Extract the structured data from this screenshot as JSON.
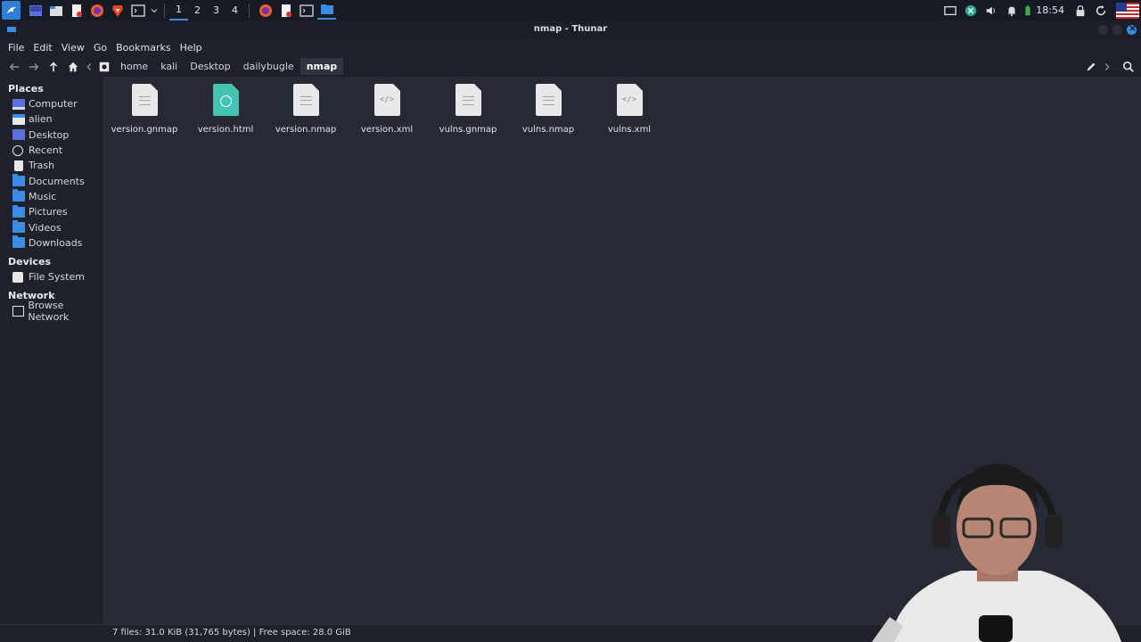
{
  "panel": {
    "workspaces": [
      "1",
      "2",
      "3",
      "4"
    ],
    "active_workspace": "1",
    "clock": "18:54",
    "launcher_icons": [
      "kali-menu-icon",
      "desktop-icon",
      "file-manager-icon",
      "text-editor-icon",
      "firefox-icon",
      "brave-icon",
      "terminal-icon"
    ],
    "task_icons": [
      "firefox-task-icon",
      "text-editor-task-icon",
      "terminal-task-icon",
      "file-manager-task-icon"
    ]
  },
  "window": {
    "title": "nmap - Thunar"
  },
  "menubar": {
    "items": [
      "File",
      "Edit",
      "View",
      "Go",
      "Bookmarks",
      "Help"
    ]
  },
  "breadcrumb": {
    "items": [
      "home",
      "kali",
      "Desktop",
      "dailybugle",
      "nmap"
    ]
  },
  "sidebar": {
    "places_header": "Places",
    "places": [
      "Computer",
      "alien",
      "Desktop",
      "Recent",
      "Trash",
      "Documents",
      "Music",
      "Pictures",
      "Videos",
      "Downloads"
    ],
    "devices_header": "Devices",
    "devices": [
      "File System"
    ],
    "network_header": "Network",
    "network": [
      "Browse Network"
    ]
  },
  "files": [
    {
      "name": "version.gnmap",
      "type": "text"
    },
    {
      "name": "version.html",
      "type": "html"
    },
    {
      "name": "version.nmap",
      "type": "text"
    },
    {
      "name": "version.xml",
      "type": "xml"
    },
    {
      "name": "vulns.gnmap",
      "type": "text"
    },
    {
      "name": "vulns.nmap",
      "type": "text"
    },
    {
      "name": "vulns.xml",
      "type": "xml"
    }
  ],
  "statusbar": {
    "text": "7 files: 31.0 KiB (31,765 bytes)  |  Free space: 28.0 GiB"
  },
  "colors": {
    "accent": "#3b8de4",
    "html_file": "#44c3b3",
    "background": "#262a35"
  }
}
